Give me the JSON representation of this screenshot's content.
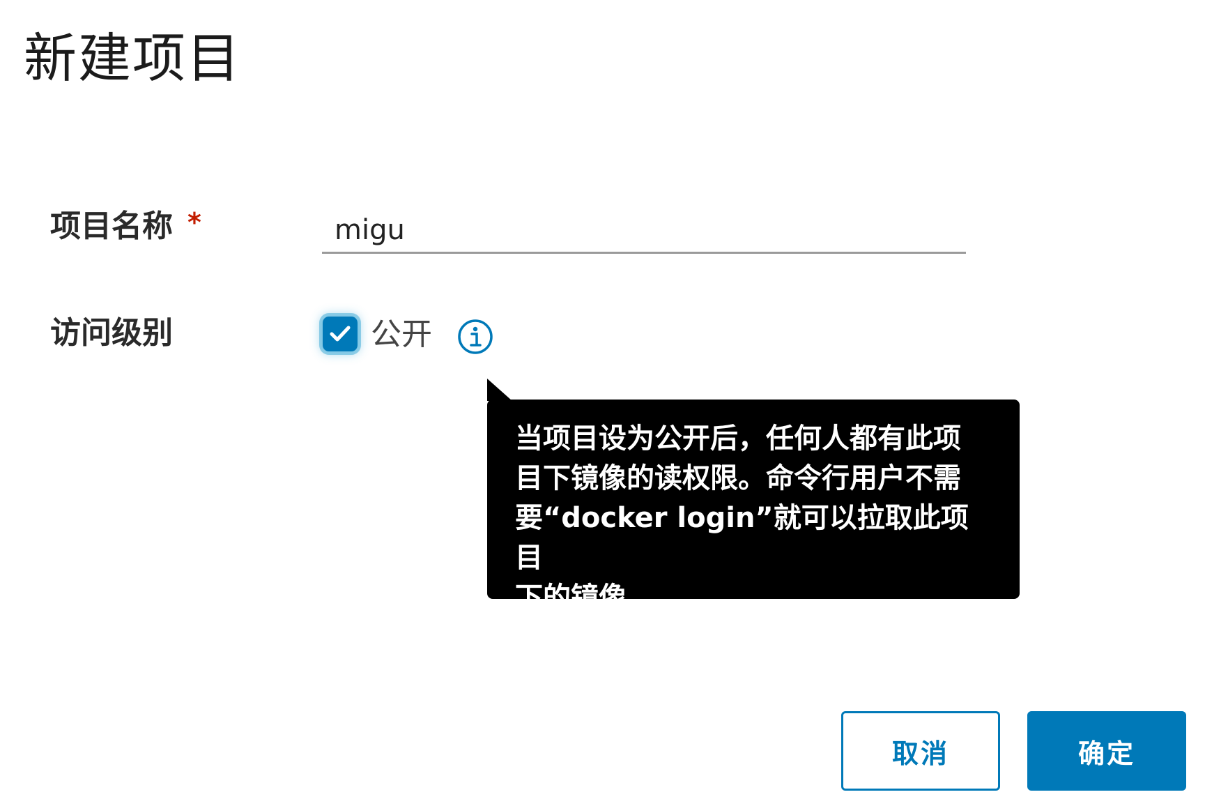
{
  "dialog": {
    "title": "新建项目"
  },
  "form": {
    "project_name": {
      "label": "项目名称",
      "required_mark": "*",
      "value": "migu"
    },
    "access_level": {
      "label": "访问级别",
      "option_label": "公开",
      "checked": true,
      "info_icon": "info-circle-icon",
      "tooltip_lines": [
        "当项目设为公开后，任何人都有此项",
        "目下镜像的读权限。命令行用户不需",
        "要“docker login”就可以拉取此项目",
        "下的镜像。"
      ]
    }
  },
  "actions": {
    "cancel_label": "取消",
    "confirm_label": "确定"
  },
  "colors": {
    "accent": "#0079b8",
    "required": "#c21d00",
    "tooltip_bg": "#000000"
  }
}
